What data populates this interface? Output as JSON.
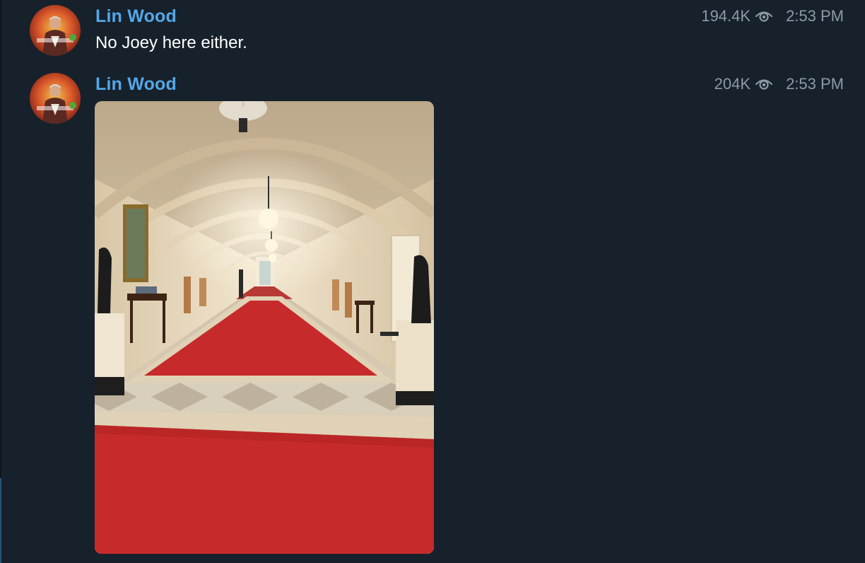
{
  "messages": [
    {
      "sender": "Lin Wood",
      "views": "194.4K",
      "time": "2:53 PM",
      "text": "No Joey here either.",
      "avatar_icon": "profile-photo-icon"
    },
    {
      "sender": "Lin Wood",
      "views": "204K",
      "time": "2:53 PM",
      "attachment": "photo",
      "avatar_icon": "profile-photo-icon"
    }
  ],
  "icons": {
    "views": "eye-icon"
  },
  "colors": {
    "background": "#17212b",
    "sender_name": "#53a8e8",
    "meta_text": "#8b9aa8",
    "message_text": "#ffffff",
    "carpet_red": "#c72a2a"
  }
}
